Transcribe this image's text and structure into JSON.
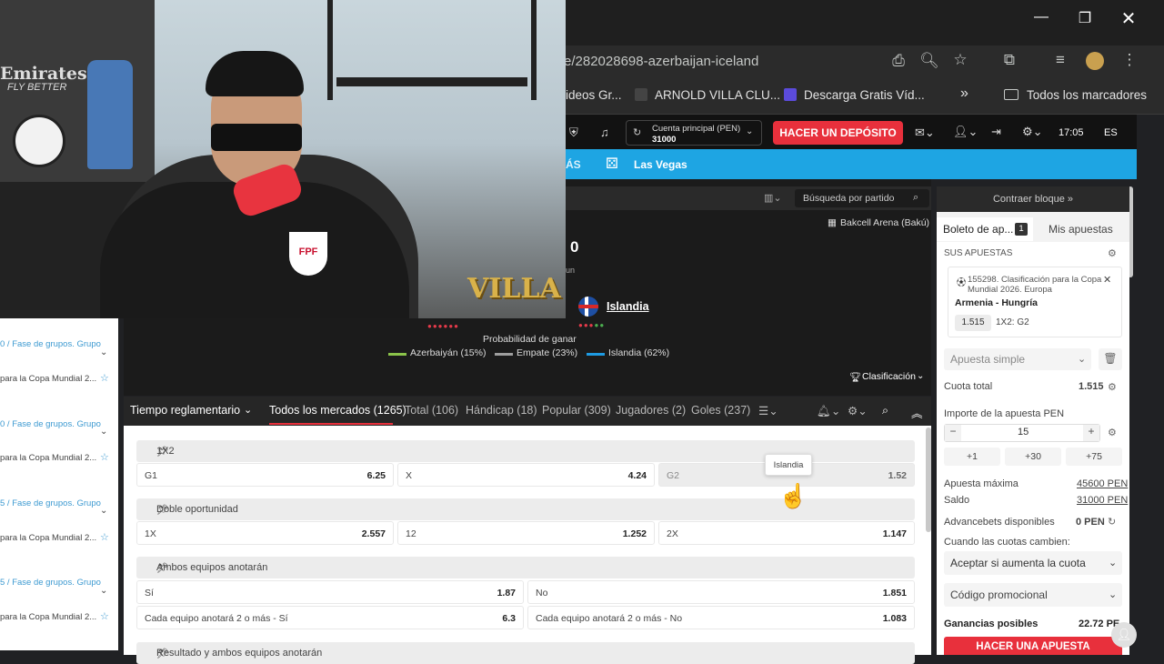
{
  "browser": {
    "url": "e/282028698-azerbaijan-iceland",
    "bookmarks": [
      "ideos Gr...",
      "ARNOLD VILLA CLU...",
      "Descarga Gratis Víd...",
      "Todos los marcadores"
    ],
    "more_label": "»"
  },
  "header": {
    "account_label": "Cuenta principal (PEN)",
    "account_balance": "31000",
    "deposit_label": "HACER UN DEPÓSITO",
    "time": "17:05",
    "lang": "ES"
  },
  "nav": {
    "more_label": "ÁS",
    "vegas_label": "Las Vegas"
  },
  "event": {
    "search_placeholder": "Búsqueda por partido",
    "venue": "Bakcell Arena (Bakú)",
    "score": "0",
    "score_sub": "un",
    "team_away": "Islandia",
    "probability_title": "Probabilidad de ganar",
    "prob_home": "Azerbaiyán (15%)",
    "prob_draw": "Empate (23%)",
    "prob_away": "Islandia (62%)",
    "classification_label": "Clasificación",
    "overlay_logo_text": "VILLA"
  },
  "markets_tabs": {
    "period": "Tiempo reglamentario",
    "tabs": [
      "Todos los mercados (1265)",
      "Total (106)",
      "Hándicap (18)",
      "Popular (309)",
      "Jugadores (2)",
      "Goles (237)"
    ]
  },
  "markets": [
    {
      "title": "1X2",
      "odds": [
        {
          "label": "G1",
          "value": "6.25"
        },
        {
          "label": "X",
          "value": "4.24"
        },
        {
          "label": "G2",
          "value": "1.52"
        }
      ]
    },
    {
      "title": "Doble oportunidad",
      "odds": [
        {
          "label": "1X",
          "value": "2.557"
        },
        {
          "label": "12",
          "value": "1.252"
        },
        {
          "label": "2X",
          "value": "1.147"
        }
      ]
    },
    {
      "title": "Ambos equipos anotarán",
      "odds": [
        {
          "label": "Sí",
          "value": "1.87"
        },
        {
          "label": "No",
          "value": "1.851"
        },
        {
          "label": "Cada equipo anotará 2 o más - Sí",
          "value": "6.3"
        },
        {
          "label": "Cada equipo anotará 2 o más - No",
          "value": "1.083"
        }
      ]
    },
    {
      "title": "Resultado y ambos equipos anotarán"
    }
  ],
  "tooltip": "Islandia",
  "betslip": {
    "collapse_label": "Contraer bloque »",
    "tab_slip": "Boleto de ap...",
    "slip_count": "1",
    "tab_my_bets": "Mis apuestas",
    "your_bets": "SUS APUESTAS",
    "bet_event": "155298. Clasificación para la Copa Mundial 2026. Europa",
    "bet_match": "Armenia - Hungría",
    "bet_odds": "1.515",
    "bet_pick": "1X2: G2",
    "bet_type": "Apuesta simple",
    "total_odds_label": "Cuota total",
    "total_odds": "1.515",
    "stake_label": "Importe de la apuesta PEN",
    "stake_value": "15",
    "quick": [
      "+1",
      "+30",
      "+75"
    ],
    "max_bet_label": "Apuesta máxima",
    "max_bet": "45600 PEN",
    "balance_label": "Saldo",
    "balance": "31000 PEN",
    "advance_label": "Advancebets disponibles",
    "advance": "0 PEN",
    "odds_change_label": "Cuando las cuotas cambien:",
    "odds_change_value": "Aceptar si aumenta la cuota",
    "promo_label": "Código promocional",
    "winnings_label": "Ganancias posibles",
    "winnings": "22.72 PE",
    "place_bet": "HACER UNA APUESTA"
  },
  "left_list": [
    {
      "group": "0 / Fase de grupos. Grupo",
      "name": "para la Copa Mundial 2..."
    },
    {
      "group": "0 / Fase de grupos. Grupo",
      "name": "para la Copa Mundial 2..."
    },
    {
      "group": "5 / Fase de grupos. Grupo",
      "name": "para la Copa Mundial 2..."
    },
    {
      "group": "5 / Fase de grupos. Grupo",
      "name": "para la Copa Mundial 2..."
    }
  ],
  "webcam": {
    "sponsor": "Emirates",
    "sponsor_sub": "FLY BETTER",
    "jersey": "FPF"
  },
  "colors": {
    "accent": "#1ea5e3",
    "deposit": "#e8303c",
    "home": "#8bc34a",
    "draw": "#9e9e9e",
    "away": "#1e9be3"
  }
}
